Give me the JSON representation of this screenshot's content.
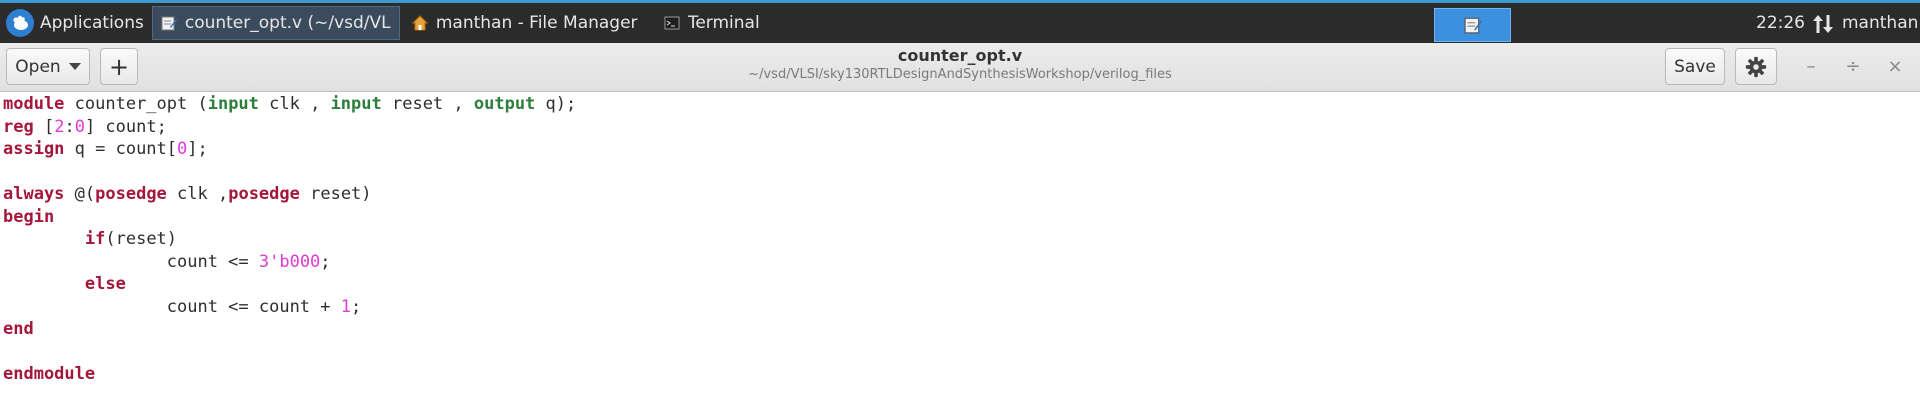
{
  "taskbar": {
    "applications_label": "Applications",
    "tasks": [
      {
        "label": "counter_opt.v (~/vsd/VL...",
        "icon": "text-editor-icon",
        "active": true
      },
      {
        "label": "manthan - File Manager",
        "icon": "home-folder-icon",
        "active": false
      },
      {
        "label": "Terminal",
        "icon": "terminal-icon",
        "active": false
      }
    ],
    "clock": "22:26",
    "user": "manthan"
  },
  "headerbar": {
    "open_label": "Open",
    "new_tab_label": "+",
    "title": "counter_opt.v",
    "path": "~/vsd/VLSI/sky130RTLDesignAndSynthesisWorkshop/verilog_files",
    "save_label": "Save",
    "minimize_label": "–",
    "maximize_label": "÷",
    "close_label": "×"
  },
  "editor": {
    "lines": [
      [
        {
          "t": "kw",
          "v": "module"
        },
        {
          "t": "plain",
          "v": " counter_opt ("
        },
        {
          "t": "type",
          "v": "input"
        },
        {
          "t": "plain",
          "v": " clk , "
        },
        {
          "t": "type",
          "v": "input"
        },
        {
          "t": "plain",
          "v": " reset , "
        },
        {
          "t": "type",
          "v": "output"
        },
        {
          "t": "plain",
          "v": " q);"
        }
      ],
      [
        {
          "t": "kw",
          "v": "reg"
        },
        {
          "t": "plain",
          "v": " ["
        },
        {
          "t": "num",
          "v": "2"
        },
        {
          "t": "plain",
          "v": ":"
        },
        {
          "t": "num",
          "v": "0"
        },
        {
          "t": "plain",
          "v": "] count;"
        }
      ],
      [
        {
          "t": "kw",
          "v": "assign"
        },
        {
          "t": "plain",
          "v": " q = count["
        },
        {
          "t": "num",
          "v": "0"
        },
        {
          "t": "plain",
          "v": "];"
        }
      ],
      [],
      [
        {
          "t": "kw",
          "v": "always"
        },
        {
          "t": "plain",
          "v": " @("
        },
        {
          "t": "kw",
          "v": "posedge"
        },
        {
          "t": "plain",
          "v": " clk ,"
        },
        {
          "t": "kw",
          "v": "posedge"
        },
        {
          "t": "plain",
          "v": " reset)"
        }
      ],
      [
        {
          "t": "kw",
          "v": "begin"
        }
      ],
      [
        {
          "t": "plain",
          "v": "        "
        },
        {
          "t": "kw",
          "v": "if"
        },
        {
          "t": "plain",
          "v": "(reset)"
        }
      ],
      [
        {
          "t": "plain",
          "v": "                count <= "
        },
        {
          "t": "num",
          "v": "3'b000"
        },
        {
          "t": "plain",
          "v": ";"
        }
      ],
      [
        {
          "t": "plain",
          "v": "        "
        },
        {
          "t": "kw",
          "v": "else"
        }
      ],
      [
        {
          "t": "plain",
          "v": "                count <= count + "
        },
        {
          "t": "num",
          "v": "1"
        },
        {
          "t": "plain",
          "v": ";"
        }
      ],
      [
        {
          "t": "kw",
          "v": "end"
        }
      ],
      [],
      [
        {
          "t": "kw",
          "v": "endmodule"
        }
      ]
    ]
  }
}
